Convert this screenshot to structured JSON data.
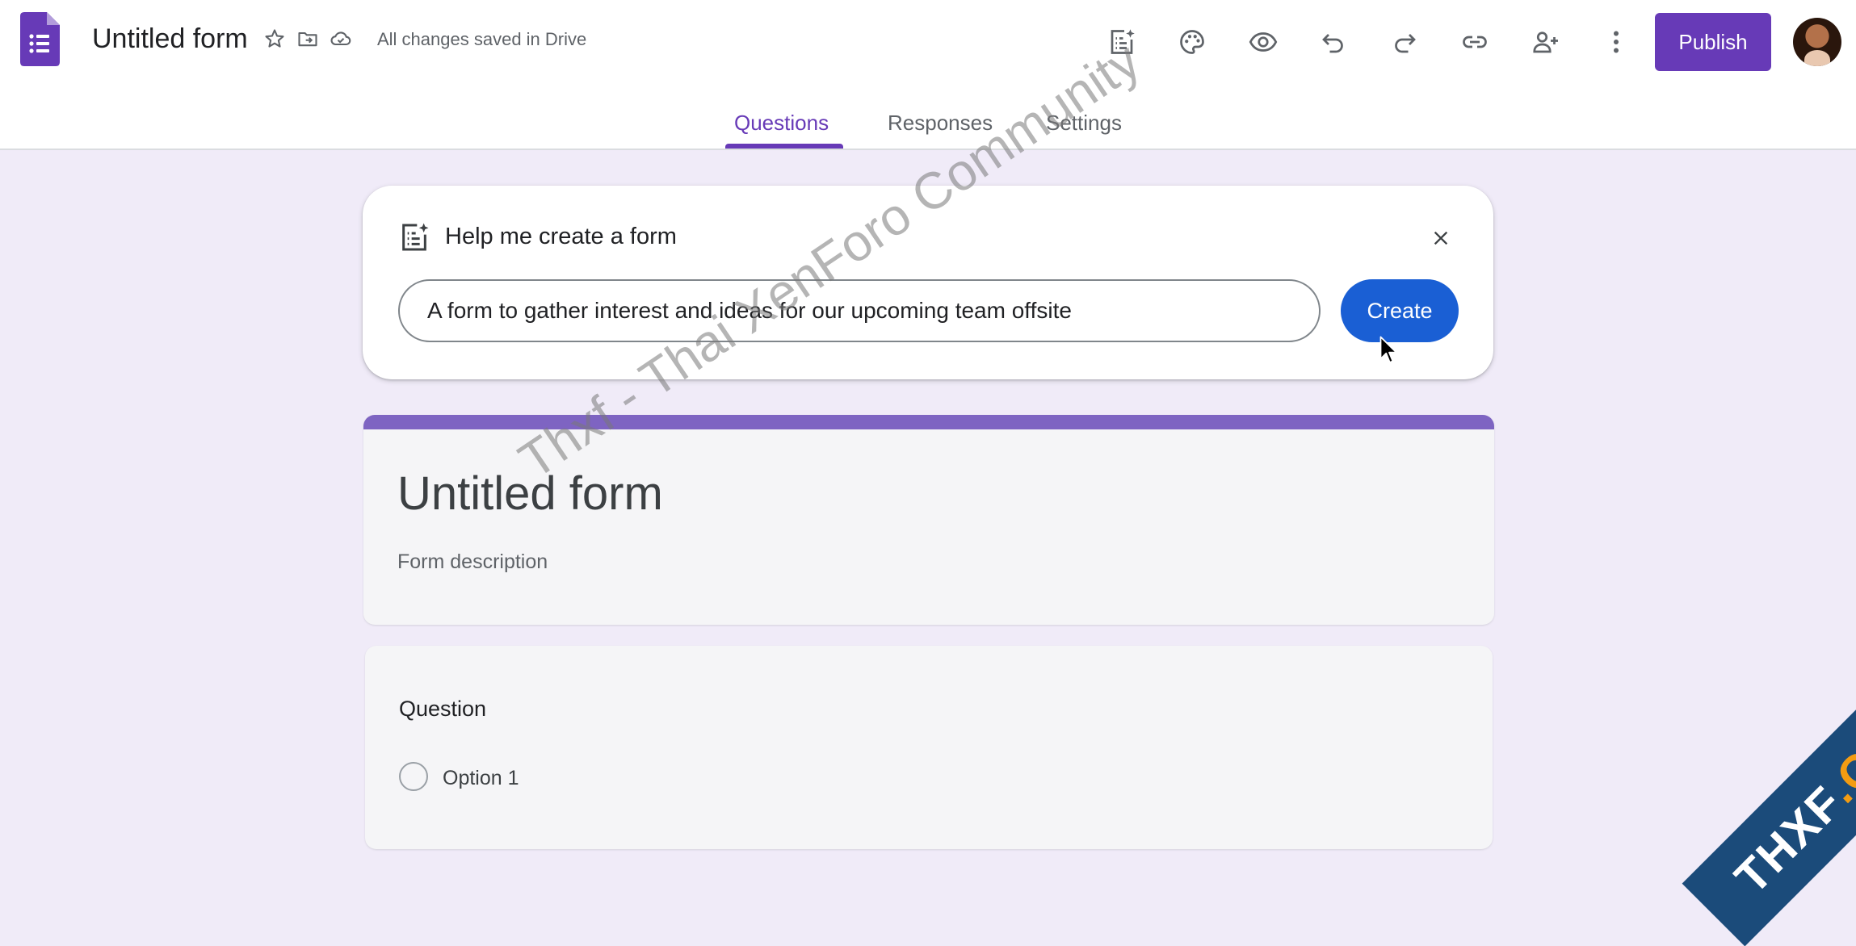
{
  "header": {
    "doc_title": "Untitled form",
    "save_status": "All changes saved in Drive",
    "publish_label": "Publish",
    "title_icons": [
      "star-icon",
      "move-to-folder-icon",
      "cloud-saved-icon"
    ],
    "toolbar_icons": [
      "ai-form-icon",
      "palette-icon",
      "preview-eye-icon",
      "undo-icon",
      "redo-icon",
      "link-icon",
      "add-collaborator-icon",
      "more-vert-icon"
    ],
    "accent_color": "#673ab7"
  },
  "tabs": [
    {
      "label": "Questions",
      "active": true
    },
    {
      "label": "Responses",
      "active": false
    },
    {
      "label": "Settings",
      "active": false
    }
  ],
  "help_card": {
    "title": "Help me create a form",
    "prompt_value": "A form to gather interest and ideas for our upcoming team offsite",
    "create_label": "Create",
    "create_color": "#1a5fd4"
  },
  "form": {
    "title": "Untitled form",
    "description_placeholder": "Form description"
  },
  "question": {
    "title": "Question",
    "options": [
      "Option 1"
    ]
  },
  "watermark": "Thxf - Thai XenForo Community",
  "corner_banner": {
    "part1": "THXF",
    "part2": ".ORG"
  }
}
